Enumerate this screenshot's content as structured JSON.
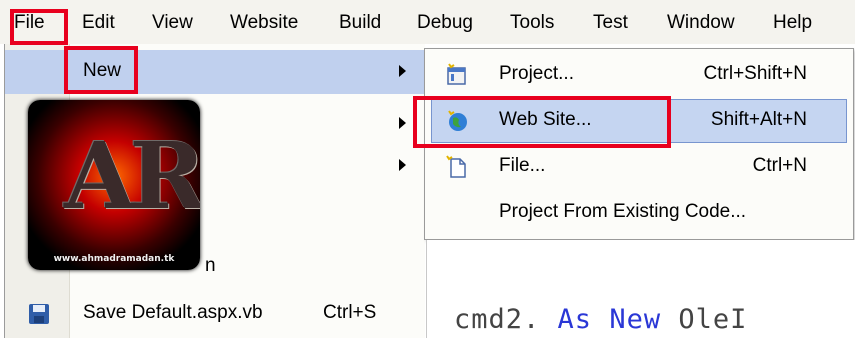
{
  "menubar": {
    "items": [
      "File",
      "Edit",
      "View",
      "Website",
      "Build",
      "Debug",
      "Tools",
      "Test",
      "Window",
      "Help"
    ]
  },
  "file_menu": {
    "new": "New",
    "partial_item": "n",
    "save": "Save Default.aspx.vb",
    "save_shortcut": "Ctrl+S"
  },
  "new_submenu": {
    "items": [
      {
        "label": "Project...",
        "shortcut": "Ctrl+Shift+N"
      },
      {
        "label": "Web Site...",
        "shortcut": "Shift+Alt+N"
      },
      {
        "label": "File...",
        "shortcut": "Ctrl+N"
      },
      {
        "label": "Project From Existing Code...",
        "shortcut": ""
      }
    ]
  },
  "logo": {
    "letters": "AR",
    "site": "www.ahmadramadan.tk"
  },
  "code_fragment": {
    "before": "cmd2.",
    "keyword": "As New",
    "after": " OleI"
  },
  "colors": {
    "annotation": "#e8001e",
    "highlight": "#c5d5f1",
    "keyword": "#2a37d6"
  }
}
